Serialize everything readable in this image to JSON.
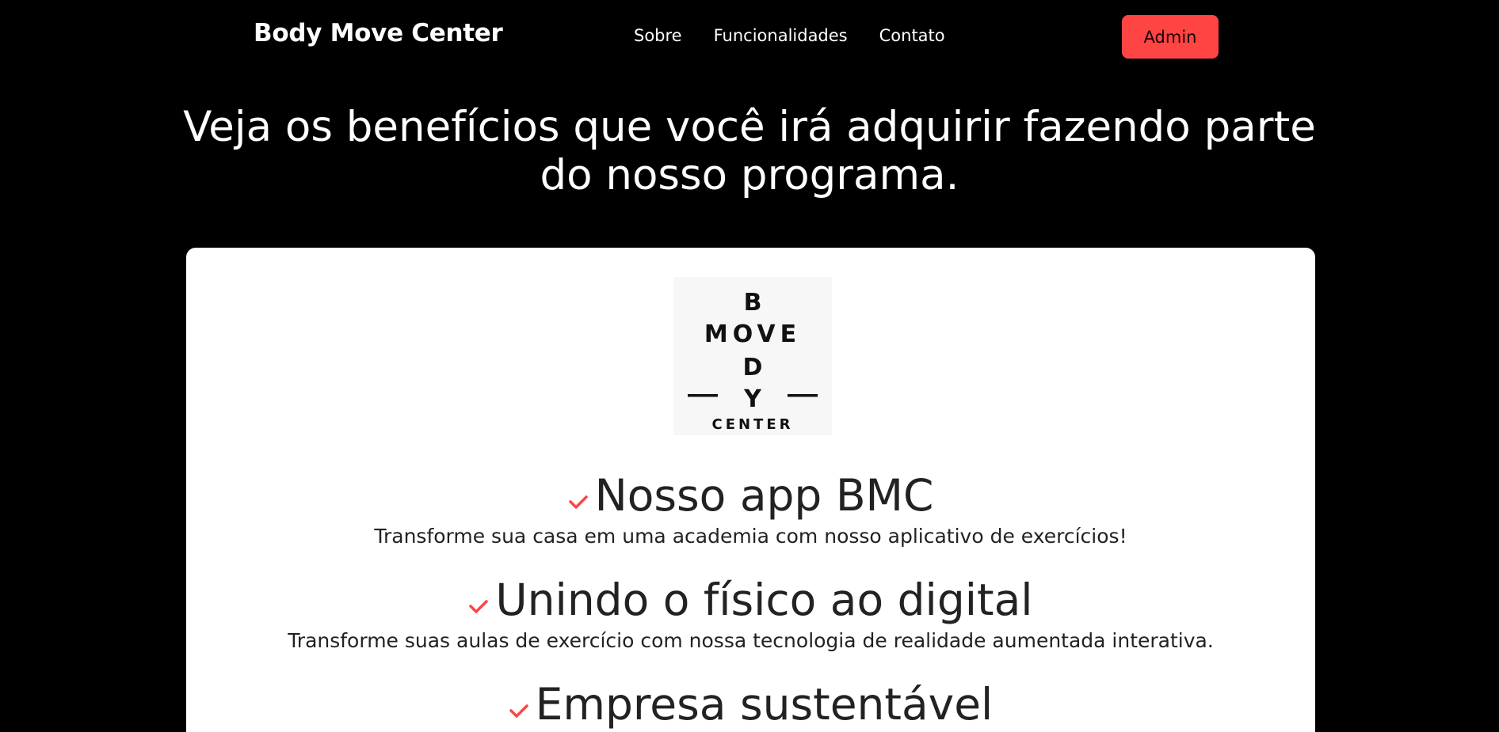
{
  "header": {
    "brand": "Body Move Center",
    "nav": [
      {
        "label": "Sobre"
      },
      {
        "label": "Funcionalidades"
      },
      {
        "label": "Contato"
      }
    ],
    "admin_label": "Admin"
  },
  "hero": {
    "title": "Veja os benefícios que você irá adquirir fazendo parte do nosso programa."
  },
  "logo": {
    "letters": {
      "b": "B",
      "move": "MOVE",
      "d": "D",
      "y": "Y",
      "center": "CENTER"
    }
  },
  "features": [
    {
      "title": "Nosso app BMC",
      "description": "Transforme sua casa em uma academia com nosso aplicativo de exercícios!",
      "icon": "check-icon"
    },
    {
      "title": "Unindo o físico ao digital",
      "description": "Transforme suas aulas de exercício com nossa tecnologia de realidade aumentada interativa.",
      "icon": "check-icon"
    },
    {
      "title": "Empresa sustentável",
      "description": "",
      "icon": "check-icon"
    }
  ],
  "colors": {
    "background": "#000000",
    "accent": "#ff4444",
    "card": "#ffffff",
    "text_dark": "#222222"
  }
}
